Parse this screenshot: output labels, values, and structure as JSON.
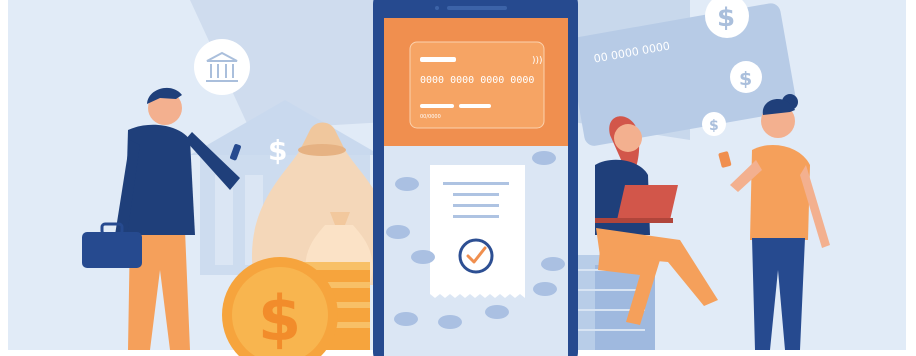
{
  "illustration": {
    "phone_card": {
      "number": "0000 0000 0000 0000",
      "expiry": "00/0000"
    },
    "background_card": {
      "number": "00 0000 0000"
    },
    "dollar_symbol": "$",
    "colors": {
      "background": "#dfe9f6",
      "phone_frame": "#264a8f",
      "card_orange": "#f08f4f",
      "accent_orange": "#f5a05b",
      "navy": "#1f3f7a",
      "coin_gold": "#f7b23b",
      "light_blue": "#bcd1ea"
    }
  }
}
